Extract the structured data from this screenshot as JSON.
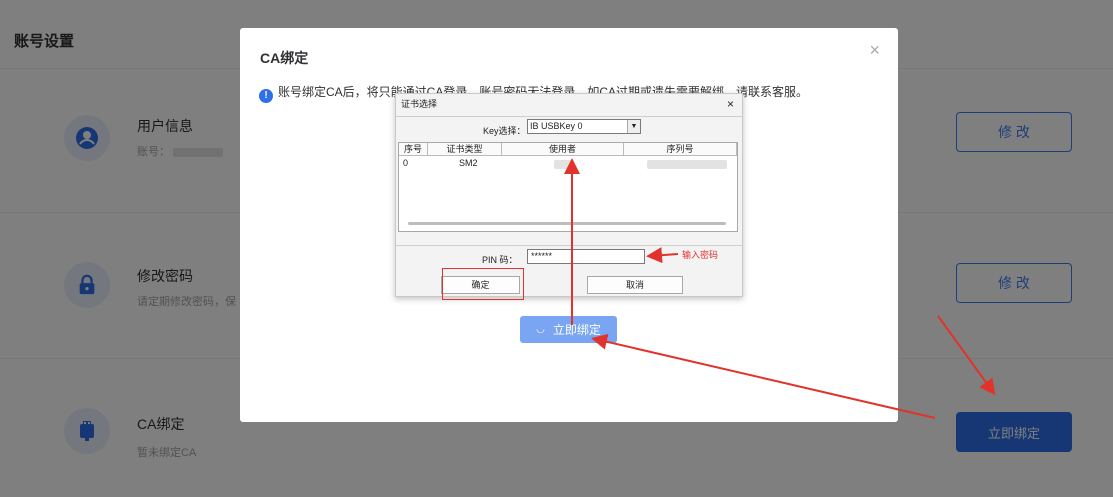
{
  "page": {
    "title": "账号设置"
  },
  "rows": [
    {
      "name": "用户信息",
      "desc_prefix": "账号：",
      "button": "修 改"
    },
    {
      "name": "修改密码",
      "desc": "请定期修改密码，保",
      "button": "修 改"
    },
    {
      "name": "CA绑定",
      "desc": "暂未绑定CA",
      "button": "立即绑定"
    }
  ],
  "modal": {
    "title": "CA绑定",
    "close": "×",
    "notice": "账号绑定CA后，将只能通过CA登录，账号密码无法登录，如CA过期或遗失需要解绑，请联系客服。",
    "bind_button": "立即绑定",
    "spinner": "◡"
  },
  "cert_dialog": {
    "title": "证书选择",
    "close": "×",
    "key_label": "Key选择：",
    "key_value": "IB USBKey 0",
    "table": {
      "headers": [
        "序号",
        "证书类型",
        "使用者",
        "序列号"
      ],
      "rows": [
        [
          "0",
          "SM2",
          "",
          ""
        ]
      ]
    },
    "pin_label": "PIN 码：",
    "pin_value": "******",
    "ok": "确定",
    "cancel": "取消"
  },
  "annotation": {
    "label": "输入密码",
    "color": "#e2322c"
  },
  "colors": {
    "primary": "#2f6fe8",
    "overlay": "rgba(0,0,0,0.5)"
  }
}
